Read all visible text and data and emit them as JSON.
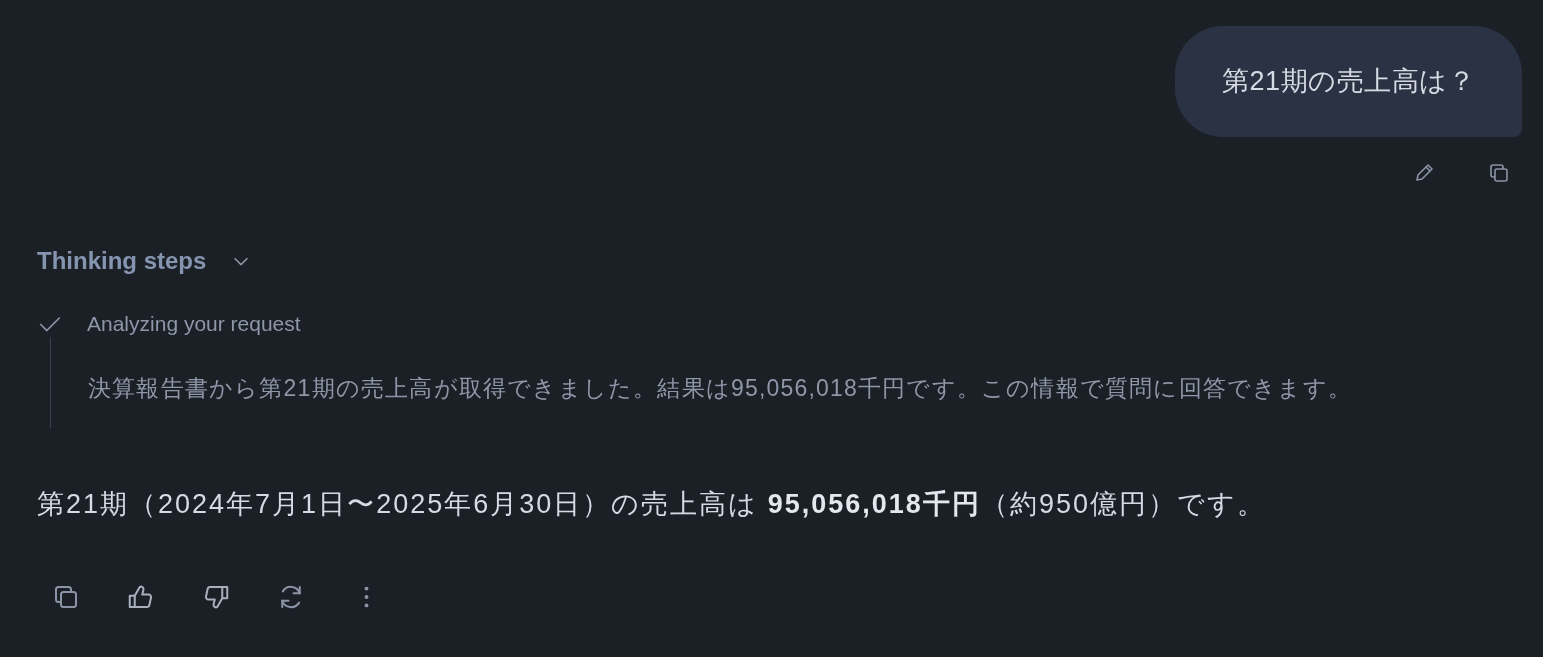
{
  "user_message": {
    "text": "第21期の売上高は？"
  },
  "thinking": {
    "title": "Thinking steps",
    "expanded": true,
    "steps": [
      {
        "label": "Analyzing your request",
        "done": true,
        "detail": "決算報告書から第21期の売上高が取得できました。結果は95,056,018千円です。この情報で質問に回答できます。"
      }
    ]
  },
  "answer": {
    "text": "第21期（2024年7月1日〜2025年6月30日）の売上高は **95,056,018千円**（約950億円）です。"
  }
}
